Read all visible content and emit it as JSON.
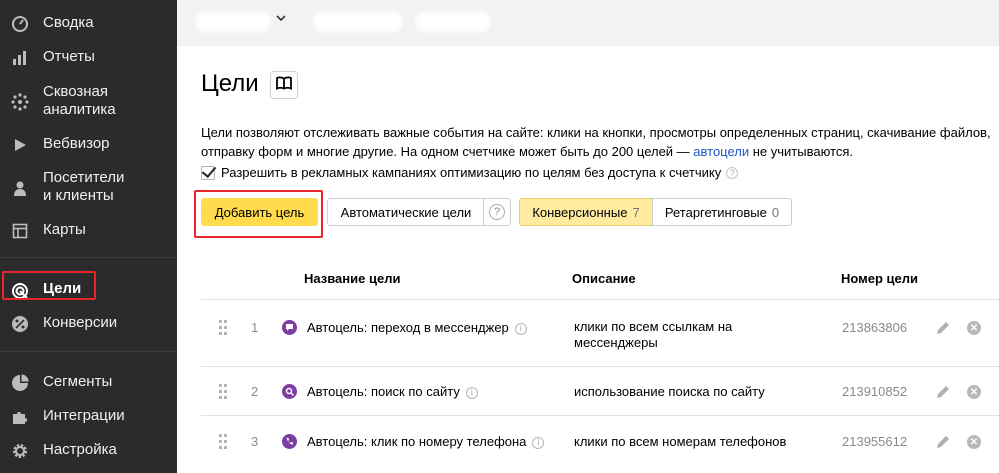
{
  "sidebar": {
    "items": [
      {
        "label": "Сводка",
        "icon": "dashboard-gauge-icon"
      },
      {
        "label": "Отчеты",
        "icon": "bar-chart-icon"
      },
      {
        "label": "Сквозная\nаналитика",
        "icon": "crossflow-analytics-icon"
      },
      {
        "label": "Вебвизор",
        "icon": "play-icon"
      },
      {
        "label": "Посетители\nи клиенты",
        "icon": "person-icon"
      },
      {
        "label": "Карты",
        "icon": "map-layout-icon"
      },
      {
        "label": "Цели",
        "icon": "target-icon",
        "active": true
      },
      {
        "label": "Конверсии",
        "icon": "percent-icon"
      },
      {
        "label": "Сегменты",
        "icon": "pie-segment-icon"
      },
      {
        "label": "Интеграции",
        "icon": "puzzle-icon"
      },
      {
        "label": "Настройка",
        "icon": "gear-icon"
      }
    ]
  },
  "main": {
    "title": "Цели",
    "description_text": "Цели позволяют отслеживать важные события на сайте: клики на кнопки, просмотры определенных страниц, скачивание файлов, отправку форм и многие другие. На одном счетчике может быть до 200 целей — ",
    "description_link": "автоцели",
    "description_tail": " не учитываются.",
    "checkbox_label": "Разрешить в рекламных кампаниях оптимизацию по целям без доступа к счетчику",
    "checkbox_checked": true,
    "add_button": "Добавить цель",
    "auto_button": "Автоматические цели",
    "help_glyph": "?",
    "tabs": [
      {
        "label": "Конверсионные",
        "count": "7",
        "selected": true
      },
      {
        "label": "Ретаргетинговые",
        "count": "0",
        "selected": false
      }
    ]
  },
  "table": {
    "headers": {
      "name": "Название цели",
      "description": "Описание",
      "id": "Номер цели"
    },
    "rows": [
      {
        "num": "1",
        "icon": "messenger-icon",
        "name": "Автоцель: переход в мессенджер",
        "description": "клики по всем ссылкам на мессенджеры",
        "id": "213863806"
      },
      {
        "num": "2",
        "icon": "search-icon",
        "name": "Автоцель: поиск по сайту",
        "description": "использование поиска по сайту",
        "id": "213910852"
      },
      {
        "num": "3",
        "icon": "phone-icon",
        "name": "Автоцель: клик по номеру телефона",
        "description": "клики по всем номерам телефонов",
        "id": "213955612"
      }
    ]
  },
  "colors": {
    "accent_yellow": "#ffdb4d",
    "sidebar_bg": "#2b2b2b",
    "highlight_red": "#e8262a",
    "goal_icon": "#7a3fa3",
    "link": "#1a56c7"
  }
}
